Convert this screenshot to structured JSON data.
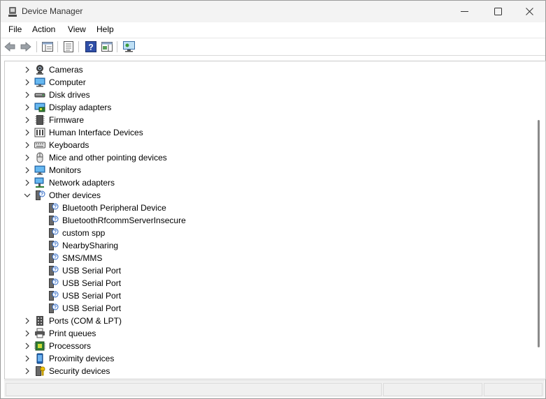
{
  "window": {
    "title": "Device Manager",
    "controls": {
      "minimize": "minimize-icon",
      "maximize": "maximize-icon",
      "close": "close-icon"
    }
  },
  "menu": [
    "File",
    "Action",
    "View",
    "Help"
  ],
  "toolbar": [
    "back-icon",
    "forward-icon",
    "show-hide-console-tree-icon",
    "properties-icon",
    "help-icon",
    "action-pane-icon",
    "scan-hardware-icon"
  ],
  "tree": {
    "items": [
      {
        "label": "Cameras",
        "icon": "camera-icon",
        "expanded": false
      },
      {
        "label": "Computer",
        "icon": "computer-icon",
        "expanded": false
      },
      {
        "label": "Disk drives",
        "icon": "disk-drive-icon",
        "expanded": false
      },
      {
        "label": "Display adapters",
        "icon": "display-adapter-icon",
        "expanded": false
      },
      {
        "label": "Firmware",
        "icon": "firmware-icon",
        "expanded": false
      },
      {
        "label": "Human Interface Devices",
        "icon": "hid-icon",
        "expanded": false
      },
      {
        "label": "Keyboards",
        "icon": "keyboard-icon",
        "expanded": false
      },
      {
        "label": "Mice and other pointing devices",
        "icon": "mouse-icon",
        "expanded": false
      },
      {
        "label": "Monitors",
        "icon": "monitor-icon",
        "expanded": false
      },
      {
        "label": "Network adapters",
        "icon": "network-adapter-icon",
        "expanded": false
      },
      {
        "label": "Other devices",
        "icon": "unknown-device-icon",
        "expanded": true,
        "children": [
          {
            "label": "Bluetooth Peripheral Device",
            "icon": "unknown-device-icon"
          },
          {
            "label": "BluetoothRfcommServerInsecure",
            "icon": "unknown-device-icon"
          },
          {
            "label": "custom spp",
            "icon": "unknown-device-icon"
          },
          {
            "label": "NearbySharing",
            "icon": "unknown-device-icon"
          },
          {
            "label": "SMS/MMS",
            "icon": "unknown-device-icon"
          },
          {
            "label": "USB Serial Port",
            "icon": "unknown-device-icon"
          },
          {
            "label": "USB Serial Port",
            "icon": "unknown-device-icon"
          },
          {
            "label": "USB Serial Port",
            "icon": "unknown-device-icon"
          },
          {
            "label": "USB Serial Port",
            "icon": "unknown-device-icon"
          }
        ]
      },
      {
        "label": "Ports (COM & LPT)",
        "icon": "port-icon",
        "expanded": false
      },
      {
        "label": "Print queues",
        "icon": "printer-icon",
        "expanded": false
      },
      {
        "label": "Processors",
        "icon": "processor-icon",
        "expanded": false
      },
      {
        "label": "Proximity devices",
        "icon": "proximity-device-icon",
        "expanded": false
      },
      {
        "label": "Security devices",
        "icon": "security-device-icon",
        "expanded": false
      }
    ]
  }
}
